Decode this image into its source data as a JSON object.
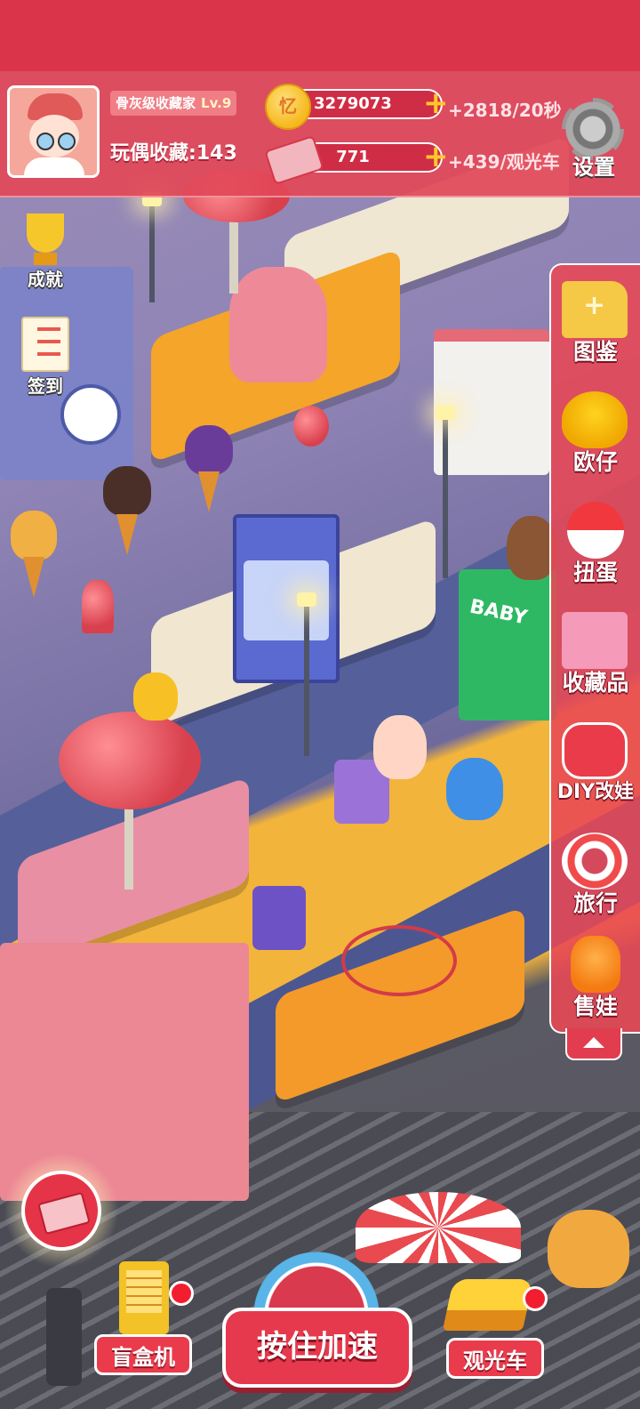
{
  "status": {
    "rank_title": "骨灰级收藏家",
    "level": "Lv.9",
    "collection_label": "玩偶收藏",
    "collection_sep": ":",
    "collection_count": "143"
  },
  "resources": {
    "coins": "3279073",
    "coin_rate": "+2818/20秒",
    "tickets": "771",
    "ticket_rate": "+439/观光车",
    "plus_symbol": "+"
  },
  "settings_label": "设置",
  "left_buttons": [
    {
      "label": "成就",
      "icon": "trophy-icon"
    },
    {
      "label": "签到",
      "icon": "checklist-icon"
    }
  ],
  "right_menu": [
    {
      "label": "图鉴",
      "icon": "folder-icon"
    },
    {
      "label": "欧仔",
      "icon": "ouzai-icon"
    },
    {
      "label": "扭蛋",
      "icon": "gacha-icon"
    },
    {
      "label": "收藏品",
      "icon": "cabinet-icon"
    },
    {
      "label": "DIY改娃",
      "icon": "gamepad-icon"
    },
    {
      "label": "旅行",
      "icon": "lifebuoy-icon"
    },
    {
      "label": "售娃",
      "icon": "gummy-bear-icon"
    }
  ],
  "bottom": {
    "blind_box_label": "盲盒机",
    "speed_label": "按住加速",
    "tour_car_label": "观光车"
  },
  "scene": {
    "sign_text": "BABY"
  },
  "colors": {
    "primary_red": "#e6394d",
    "gold": "#f5b81d",
    "badge_red": "#f21d2e"
  }
}
